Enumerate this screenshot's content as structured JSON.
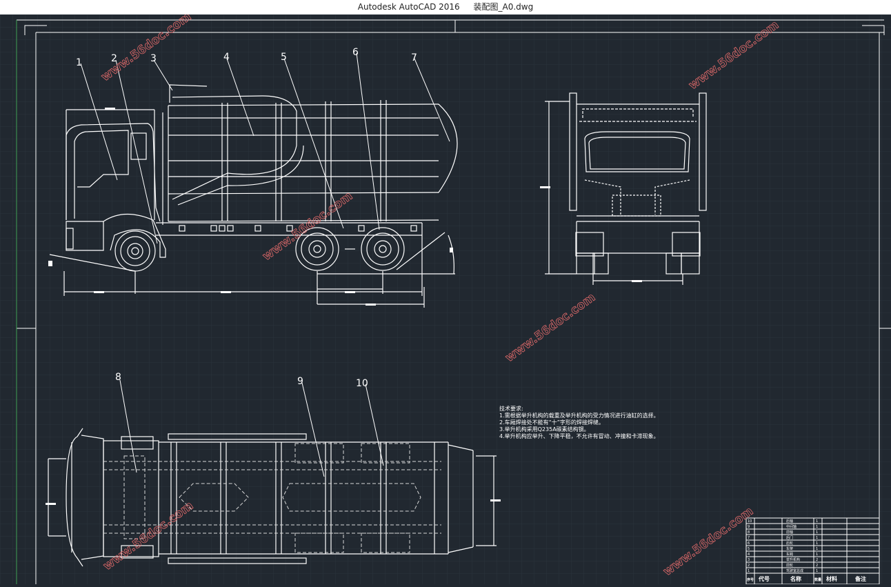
{
  "window": {
    "app_title": "Autodesk AutoCAD 2016",
    "file_name": "装配图_A0.dwg"
  },
  "balloons": [
    "1",
    "2",
    "3",
    "4",
    "5",
    "6",
    "7",
    "8",
    "9",
    "10"
  ],
  "tech": {
    "title": "技术要求:",
    "lines": [
      "1.需根据举升机构的载重及举升机构的受力情况进行油缸的选择。",
      "2.车厢焊接处不能有“十”字形的焊接焊缝。",
      "3.举升机构采用Q235A碳素结构钢。",
      "4.举升机构应举升、下降平稳，不允许有冒动、冲撞和卡滞现象。"
    ]
  },
  "bom": {
    "headers": [
      "序号",
      "代号",
      "名称",
      "数量",
      "材料",
      "备注"
    ],
    "rows": [
      {
        "no": "10",
        "name": "后轴",
        "qty": "1"
      },
      {
        "no": "9",
        "name": "中间轴",
        "qty": "1"
      },
      {
        "no": "8",
        "name": "前轴",
        "qty": "1"
      },
      {
        "no": "7",
        "name": "后门",
        "qty": "1"
      },
      {
        "no": "6",
        "name": "后轮",
        "qty": "1"
      },
      {
        "no": "5",
        "name": "车架",
        "qty": "1"
      },
      {
        "no": "4",
        "name": "车厢",
        "qty": "1"
      },
      {
        "no": "3",
        "name": "举升机构",
        "qty": "2"
      },
      {
        "no": "2",
        "name": "前轮",
        "qty": "2"
      },
      {
        "no": "1",
        "name": "驾驶室总成",
        "qty": "1"
      }
    ]
  },
  "watermark": "www.56doc.com",
  "colors": {
    "background": "#212830",
    "grid": "#2b333d",
    "lines": "#ffffff",
    "dashed": "#d8d8d8"
  }
}
